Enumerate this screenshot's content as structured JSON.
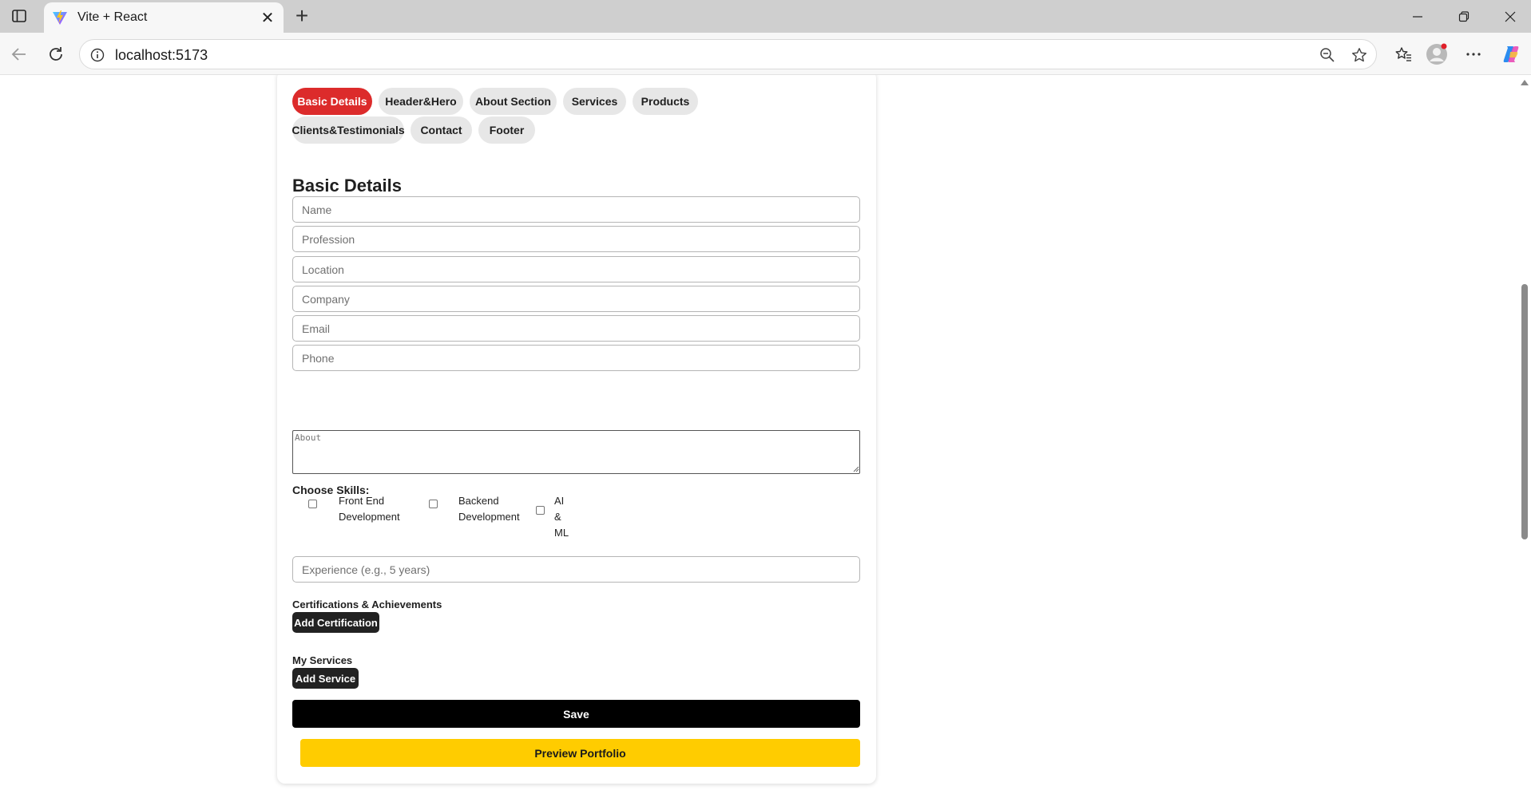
{
  "browser": {
    "tab_title": "Vite + React",
    "tab_close": "✕",
    "new_tab": "+",
    "url": "localhost:5173"
  },
  "tabs": [
    {
      "label": "Basic Details",
      "active": true
    },
    {
      "label": "Header&Hero",
      "active": false
    },
    {
      "label": "About Section",
      "active": false
    },
    {
      "label": "Services",
      "active": false
    },
    {
      "label": "Products",
      "active": false
    },
    {
      "label": "Clients&Testimonials",
      "active": false
    },
    {
      "label": "Contact",
      "active": false
    },
    {
      "label": "Footer",
      "active": false
    }
  ],
  "form": {
    "title": "Basic Details",
    "name_placeholder": "Name",
    "profession_placeholder": "Profession",
    "location_placeholder": "Location",
    "company_placeholder": "Company",
    "email_placeholder": "Email",
    "phone_placeholder": "Phone",
    "about_placeholder": "About",
    "skills_label": "Choose Skills:",
    "skills": [
      {
        "line1": "Front End",
        "line2": "Development",
        "line3": "",
        "checked": false
      },
      {
        "line1": "Backend",
        "line2": "Development",
        "line3": "",
        "checked": false
      },
      {
        "line1": "AI",
        "line2": "&",
        "line3": "ML",
        "checked": false
      }
    ],
    "experience_placeholder": "Experience (e.g., 5 years)",
    "certifications_label": "Certifications & Achievements",
    "add_certification": "Add Certification",
    "services_label": "My Services",
    "add_service": "Add Service",
    "save": "Save",
    "preview": "Preview Portfolio"
  },
  "colors": {
    "active_tab": "#dc2b2b",
    "inactive_tab": "#e7e7e7",
    "save_button": "#000000",
    "preview_button": "#ffcc00"
  }
}
